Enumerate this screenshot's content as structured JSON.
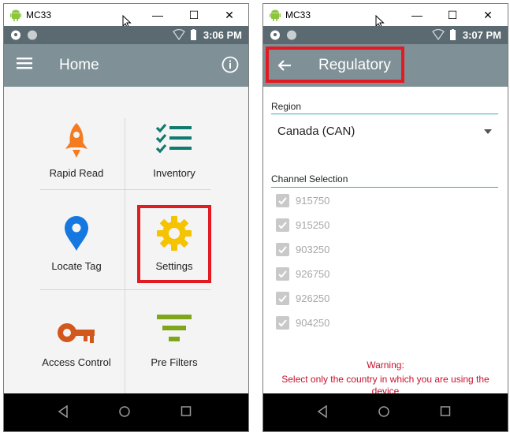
{
  "left_window": {
    "title": "MC33",
    "status": {
      "time": "3:06 PM"
    },
    "appbar": {
      "title": "Home"
    },
    "tiles": [
      {
        "label": "Rapid Read",
        "icon": "rocket-icon"
      },
      {
        "label": "Inventory",
        "icon": "checklist-icon"
      },
      {
        "label": "Locate Tag",
        "icon": "location-pin-icon"
      },
      {
        "label": "Settings",
        "icon": "gear-icon"
      },
      {
        "label": "Access Control",
        "icon": "key-icon"
      },
      {
        "label": "Pre Filters",
        "icon": "filter-icon"
      }
    ]
  },
  "right_window": {
    "title": "MC33",
    "status": {
      "time": "3:07 PM"
    },
    "appbar": {
      "title": "Regulatory"
    },
    "region": {
      "label": "Region",
      "value": "Canada (CAN)"
    },
    "channel": {
      "label": "Channel Selection",
      "items": [
        "915750",
        "915250",
        "903250",
        "926750",
        "926250",
        "904250"
      ]
    },
    "warning": {
      "title": "Warning:",
      "text": "Select only the country in which you are using the device"
    }
  },
  "colors": {
    "statusbar": "#5b6a70",
    "appbar": "#7f9197",
    "highlight": "#e21b23",
    "accent_teal": "#39a6b8",
    "warning": "#c8102e",
    "rocket": "#f47b20",
    "inventory": "#0f7a6f",
    "pin": "#1478e0",
    "gear": "#f5c300",
    "key": "#d2571c",
    "filter": "#7fa61a"
  }
}
